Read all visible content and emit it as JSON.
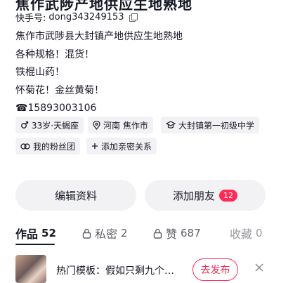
{
  "profile": {
    "title_partial": "焦作武陟产地供应生地熟地",
    "kuaishou_label": "快手号:",
    "kuaishou_id": "dong343249153",
    "bio_lines": [
      "焦作市武陟县大封镇产地供应生地熟地",
      "各种规格！混货！",
      "铁棍山药！",
      "怀菊花！金丝黄菊！",
      "☎15893003106"
    ]
  },
  "tags": {
    "age": "33岁·天蝎座",
    "location": "河南 焦作市",
    "school": "大封镇第一初级中学",
    "fans": "我的粉丝团",
    "add_relation": "添加亲密关系"
  },
  "buttons": {
    "edit": "编辑资料",
    "add_friend": "添加朋友",
    "add_friend_badge": "12"
  },
  "tabs": [
    {
      "label": "作品",
      "count": "52"
    },
    {
      "label": "私密",
      "count": "2"
    },
    {
      "label": "赞",
      "count": "687"
    },
    {
      "label": "收藏",
      "count": "0"
    }
  ],
  "promo": {
    "text": "热门模板：假如只剩九个…",
    "button": "去发布"
  }
}
